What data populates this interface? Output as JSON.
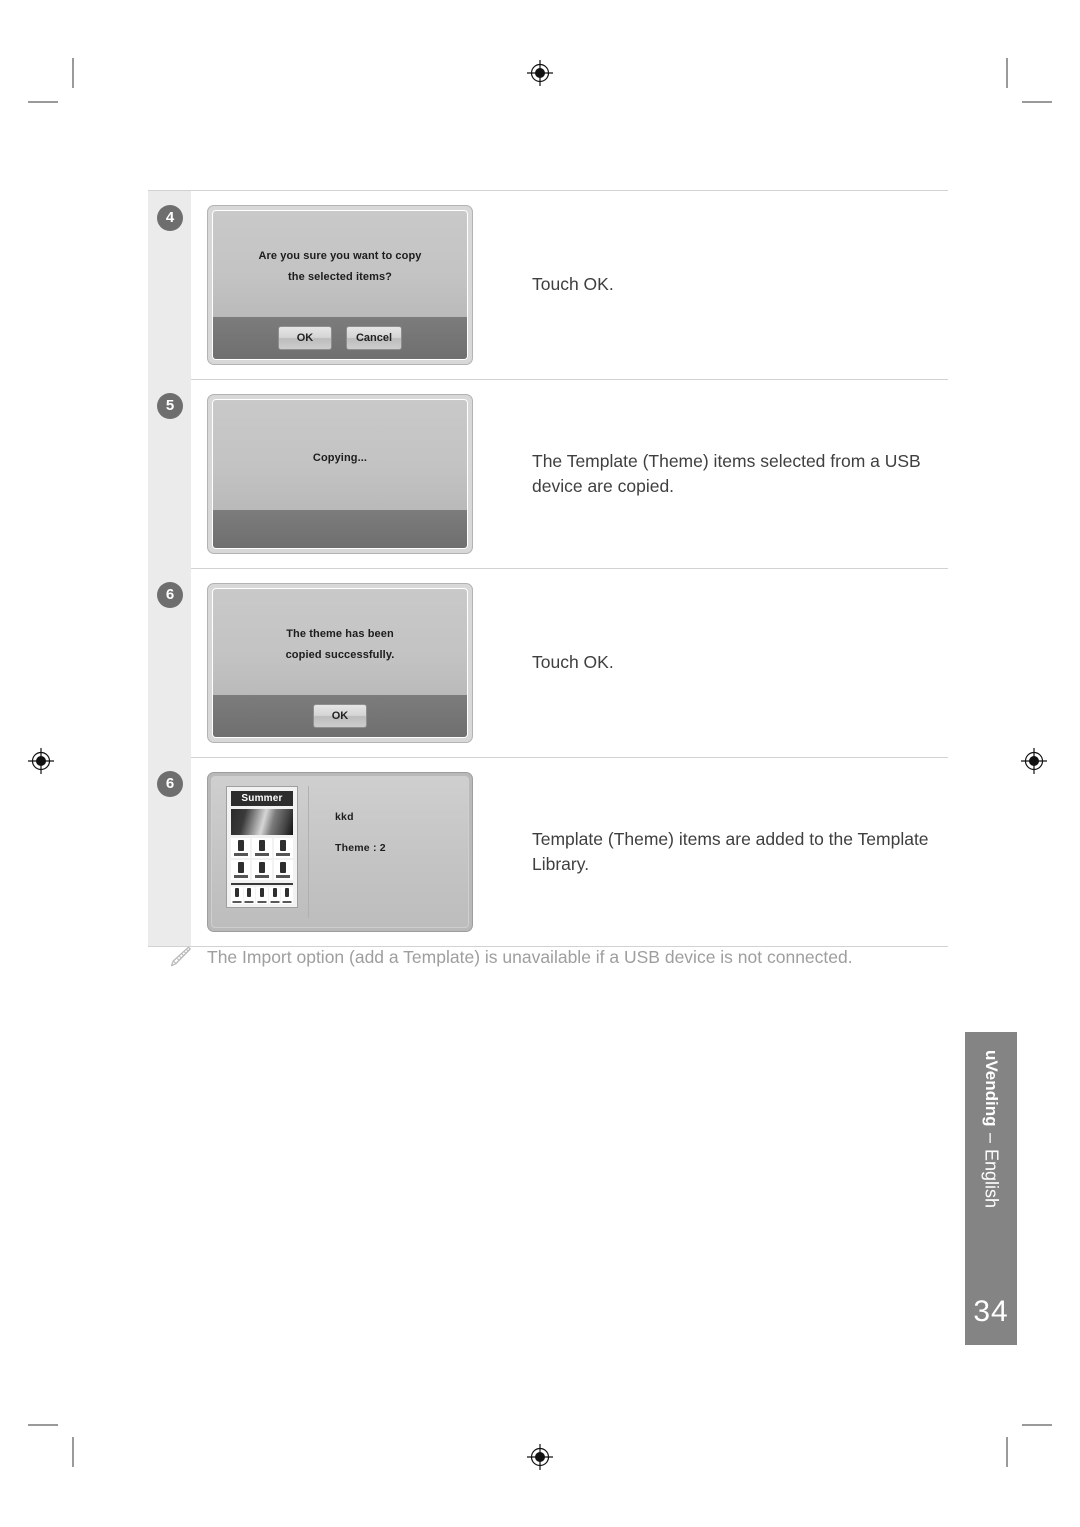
{
  "page": {
    "number": "34",
    "brand": "uVending",
    "dash": "–",
    "language": "English"
  },
  "steps": [
    {
      "badge": "4",
      "screen": {
        "kind": "confirm-dialog",
        "message_lines": [
          "Are you sure you want to copy",
          "the selected items?"
        ],
        "buttons": [
          "OK",
          "Cancel"
        ]
      },
      "description": "Touch OK."
    },
    {
      "badge": "5",
      "screen": {
        "kind": "progress-dialog",
        "message_lines": [
          "Copying..."
        ],
        "buttons": []
      },
      "description": "The Template (Theme) items selected from a USB device are copied."
    },
    {
      "badge": "6",
      "screen": {
        "kind": "confirm-dialog",
        "message_lines": [
          "The theme has been",
          "copied successfully."
        ],
        "buttons": [
          "OK"
        ]
      },
      "description": "Touch OK."
    },
    {
      "badge": "6",
      "screen": {
        "kind": "library-card",
        "thumbnail_title": "Summer",
        "meta_lines": [
          "kkd",
          "Theme : 2"
        ]
      },
      "description": "Template (Theme) items are added to the Template Library."
    }
  ],
  "note": {
    "icon": "pencil-note-icon",
    "text": "The Import option (add a Template) is unavailable if a USB device is not connected."
  },
  "colors": {
    "badge": "#6e6e6e",
    "num_column": "#ebebeb",
    "rule": "#d2d2d2",
    "note_text": "#9e9e9e",
    "side_tab": "#848484",
    "body_text": "#3f3f3f"
  }
}
